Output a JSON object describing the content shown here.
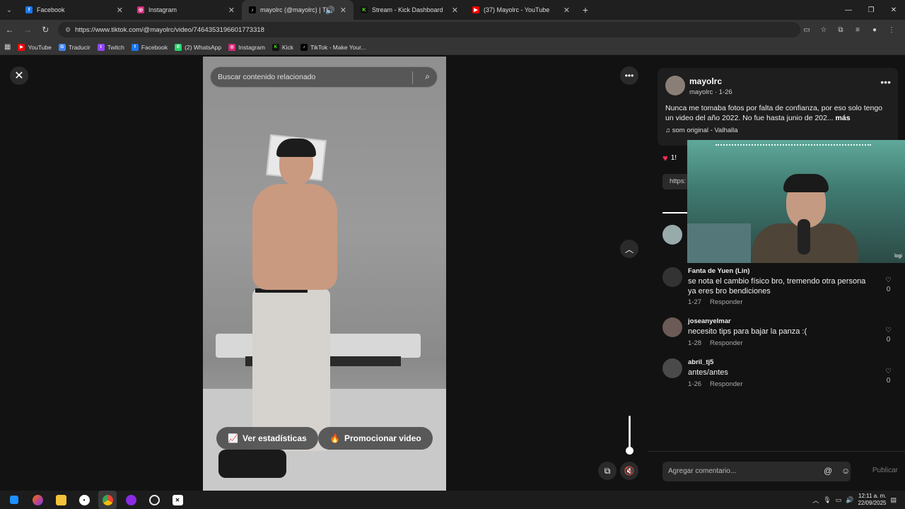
{
  "browser": {
    "tabs": [
      {
        "label": "Facebook",
        "icon": "facebook-icon",
        "color": "#1877f2"
      },
      {
        "label": "Instagram",
        "icon": "instagram-icon",
        "color": "#d62976"
      },
      {
        "label": "mayolrc (@mayolrc) | TikTok",
        "icon": "tiktok-icon",
        "color": "#000000"
      },
      {
        "label": "Stream - Kick Dashboard",
        "icon": "kick-icon",
        "color": "#53fc18"
      },
      {
        "label": "(37) Mayolrc - YouTube",
        "icon": "youtube-icon",
        "color": "#ff0000"
      }
    ],
    "url": "https://www.tiktok.com/@mayolrc/video/7464353196601773318",
    "bookmarks": [
      {
        "label": "YouTube",
        "color": "#ff0000"
      },
      {
        "label": "Traducir",
        "color": "#4285f4"
      },
      {
        "label": "Twitch",
        "color": "#9146ff"
      },
      {
        "label": "Facebook",
        "color": "#1877f2"
      },
      {
        "label": "(2) WhatsApp",
        "color": "#25d366"
      },
      {
        "label": "Instagram",
        "color": "#d62976"
      },
      {
        "label": "Kick",
        "color": "#53fc18"
      },
      {
        "label": "TikTok - Make Your...",
        "color": "#000000"
      }
    ]
  },
  "video": {
    "search_placeholder": "Buscar contenido relacionado",
    "stats_button": "Ver estadísticas",
    "promote_button": "Promocionar video"
  },
  "post": {
    "author": "mayolrc",
    "author_sub": "mayolrc · 1-26",
    "caption": "Nunca me tomaba fotos por falta de confianza, por eso solo tengo un video del año 2022. No fue hasta junio de 202...",
    "more_label": "más",
    "music": "♫ som original - Valhalla",
    "likes_partial": "1!",
    "link_partial": "https:"
  },
  "comments": [
    {
      "user": "Fanta de Yuen (Lin)",
      "text": "se nota el cambio físico bro, tremendo otra persona ya eres bro bendiciones",
      "date": "1-27",
      "reply": "Responder",
      "likes": "0"
    },
    {
      "user": "joseanyelmar",
      "text": "necesito tips para bajar la panza :(",
      "date": "1-28",
      "reply": "Responder",
      "likes": "0"
    },
    {
      "user": "abril_tj5",
      "text": "antes/antes",
      "date": "1-26",
      "reply": "Responder",
      "likes": "0"
    }
  ],
  "composer": {
    "placeholder": "Agregar comentario...",
    "publish": "Publicar"
  },
  "webcam": {
    "logo": "logi"
  },
  "taskbar": {
    "time": "12:11 a. m.",
    "date": "22/09/2025"
  }
}
